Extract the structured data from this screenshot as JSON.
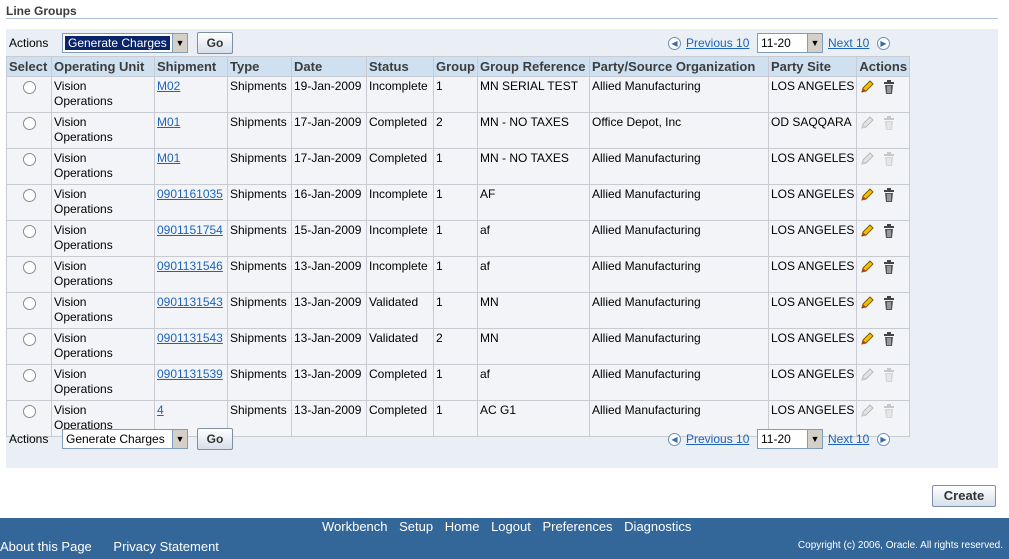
{
  "section": {
    "title": "Line Groups"
  },
  "actions_bar": {
    "label": "Actions",
    "selected_action": "Generate Charges",
    "go_label": "Go",
    "prev_label": "Previous 10",
    "range": "11-20",
    "next_label": "Next 10"
  },
  "table": {
    "columns": [
      "Select",
      "Operating Unit",
      "Shipment",
      "Type",
      "Date",
      "Status",
      "Group",
      "Group Reference",
      "Party/Source Organization",
      "Party Site",
      "Actions"
    ],
    "rows": [
      {
        "ou1": "Vision",
        "ou2": "Operations",
        "shipment": "M02",
        "type": "Shipments",
        "date": "19-Jan-2009",
        "status": "Incomplete",
        "group": "1",
        "group_ref": "MN SERIAL TEST",
        "party": "Allied Manufacturing",
        "site": "LOS ANGELES",
        "actions_enabled": true
      },
      {
        "ou1": "Vision",
        "ou2": "Operations",
        "shipment": "M01",
        "type": "Shipments",
        "date": "17-Jan-2009",
        "status": "Completed",
        "group": "2",
        "group_ref": "MN - NO TAXES",
        "party": "Office Depot, Inc",
        "site": "OD SAQQARA",
        "actions_enabled": false
      },
      {
        "ou1": "Vision",
        "ou2": "Operations",
        "shipment": "M01",
        "type": "Shipments",
        "date": "17-Jan-2009",
        "status": "Completed",
        "group": "1",
        "group_ref": "MN - NO TAXES",
        "party": "Allied Manufacturing",
        "site": "LOS ANGELES",
        "actions_enabled": false
      },
      {
        "ou1": "Vision",
        "ou2": "Operations",
        "shipment": "0901161035",
        "type": "Shipments",
        "date": "16-Jan-2009",
        "status": "Incomplete",
        "group": "1",
        "group_ref": "AF",
        "party": "Allied Manufacturing",
        "site": "LOS ANGELES",
        "actions_enabled": true
      },
      {
        "ou1": "Vision",
        "ou2": "Operations",
        "shipment": "0901151754",
        "type": "Shipments",
        "date": "15-Jan-2009",
        "status": "Incomplete",
        "group": "1",
        "group_ref": "af",
        "party": "Allied Manufacturing",
        "site": "LOS ANGELES",
        "actions_enabled": true
      },
      {
        "ou1": "Vision",
        "ou2": "Operations",
        "shipment": "0901131546",
        "type": "Shipments",
        "date": "13-Jan-2009",
        "status": "Incomplete",
        "group": "1",
        "group_ref": "af",
        "party": "Allied Manufacturing",
        "site": "LOS ANGELES",
        "actions_enabled": true
      },
      {
        "ou1": "Vision",
        "ou2": "Operations",
        "shipment": "0901131543",
        "type": "Shipments",
        "date": "13-Jan-2009",
        "status": "Validated",
        "group": "1",
        "group_ref": "MN",
        "party": "Allied Manufacturing",
        "site": "LOS ANGELES",
        "actions_enabled": true
      },
      {
        "ou1": "Vision",
        "ou2": "Operations",
        "shipment": "0901131543",
        "type": "Shipments",
        "date": "13-Jan-2009",
        "status": "Validated",
        "group": "2",
        "group_ref": "MN",
        "party": "Allied Manufacturing",
        "site": "LOS ANGELES",
        "actions_enabled": true
      },
      {
        "ou1": "Vision",
        "ou2": "Operations",
        "shipment": "0901131539",
        "type": "Shipments",
        "date": "13-Jan-2009",
        "status": "Completed",
        "group": "1",
        "group_ref": "af",
        "party": "Allied Manufacturing",
        "site": "LOS ANGELES",
        "actions_enabled": false
      },
      {
        "ou1": "Vision",
        "ou2": "Operations",
        "shipment": "4",
        "type": "Shipments",
        "date": "13-Jan-2009",
        "status": "Completed",
        "group": "1",
        "group_ref": "AC G1",
        "party": "Allied Manufacturing",
        "site": "LOS ANGELES",
        "actions_enabled": false
      }
    ]
  },
  "create_label": "Create",
  "footer": {
    "links": [
      "Workbench",
      "Setup",
      "Home",
      "Logout",
      "Preferences",
      "Diagnostics"
    ],
    "about": "About this Page",
    "privacy": "Privacy Statement",
    "copyright": "Copyright (c) 2006, Oracle. All rights reserved."
  },
  "colors": {
    "header_bg": "#cfe0f1",
    "link": "#1d64b8",
    "footer_bg": "#336699",
    "panel_bg": "#eaeff5"
  },
  "icons": {
    "edit": "pencil-icon",
    "delete": "trash-icon",
    "prev": "previous-arrow-icon",
    "next": "next-arrow-icon"
  }
}
